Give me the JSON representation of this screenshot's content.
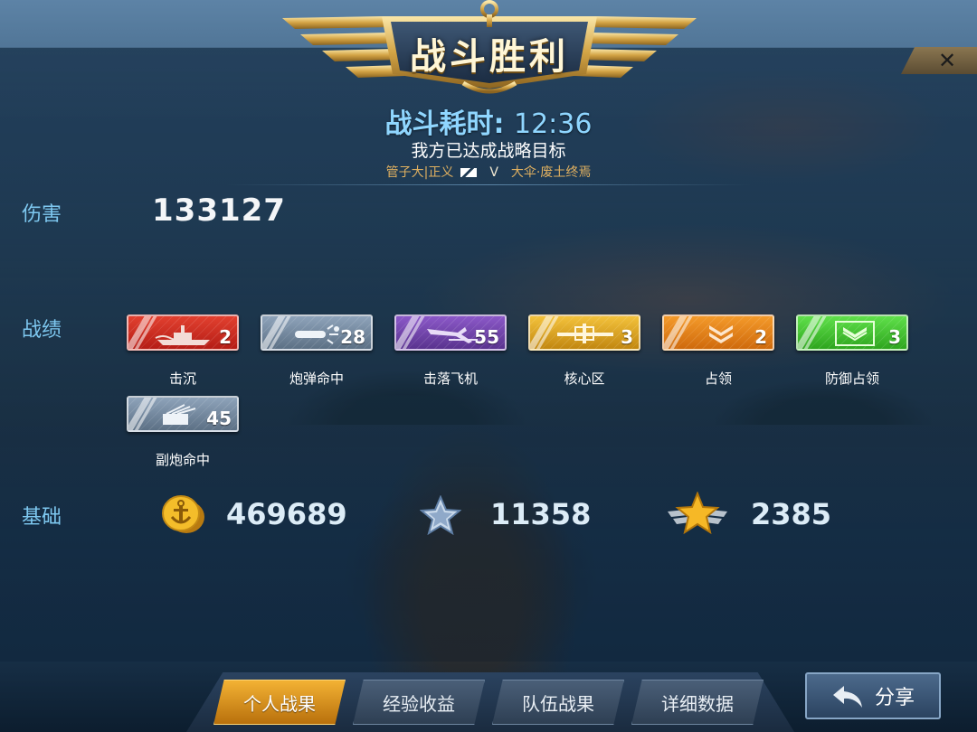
{
  "header": {
    "title": "战斗胜利",
    "close_icon": "close-icon",
    "time_label": "战斗耗时:",
    "time_value": "12:36",
    "objective": "我方已达成战略目标",
    "team_left": "管子大|正义",
    "vs": "V",
    "team_right": "大伞·废土终焉"
  },
  "damage": {
    "label": "伤害",
    "value": "133127"
  },
  "record": {
    "label": "战绩",
    "badges": [
      {
        "label": "击沉",
        "count": "2",
        "icon": "sunk-ship-icon",
        "color": "#d4301f"
      },
      {
        "label": "炮弹命中",
        "count": "28",
        "icon": "shell-hit-icon",
        "color": "#7a8ea5"
      },
      {
        "label": "击落飞机",
        "count": "55",
        "icon": "plane-shot-icon",
        "color": "#7447ae"
      },
      {
        "label": "核心区",
        "count": "3",
        "icon": "citadel-icon",
        "color": "#dca324"
      },
      {
        "label": "占领",
        "count": "2",
        "icon": "capture-chevron-icon",
        "color": "#e4821a"
      },
      {
        "label": "防御占领",
        "count": "3",
        "icon": "defend-capture-icon",
        "color": "#48c535"
      },
      {
        "label": "副炮命中",
        "count": "45",
        "icon": "secondary-gun-icon",
        "color": "#7a8ea5"
      }
    ]
  },
  "base": {
    "label": "基础",
    "coins": {
      "icon": "anchor-coin-icon",
      "value": "469689"
    },
    "exp": {
      "icon": "silver-star-icon",
      "value": "11358"
    },
    "rank": {
      "icon": "gold-star-wings-icon",
      "value": "2385"
    }
  },
  "tabs": [
    {
      "label": "个人战果",
      "active": true
    },
    {
      "label": "经验收益",
      "active": false
    },
    {
      "label": "队伍战果",
      "active": false
    },
    {
      "label": "详细数据",
      "active": false
    }
  ],
  "share": {
    "label": "分享",
    "icon": "share-arrow-icon"
  }
}
